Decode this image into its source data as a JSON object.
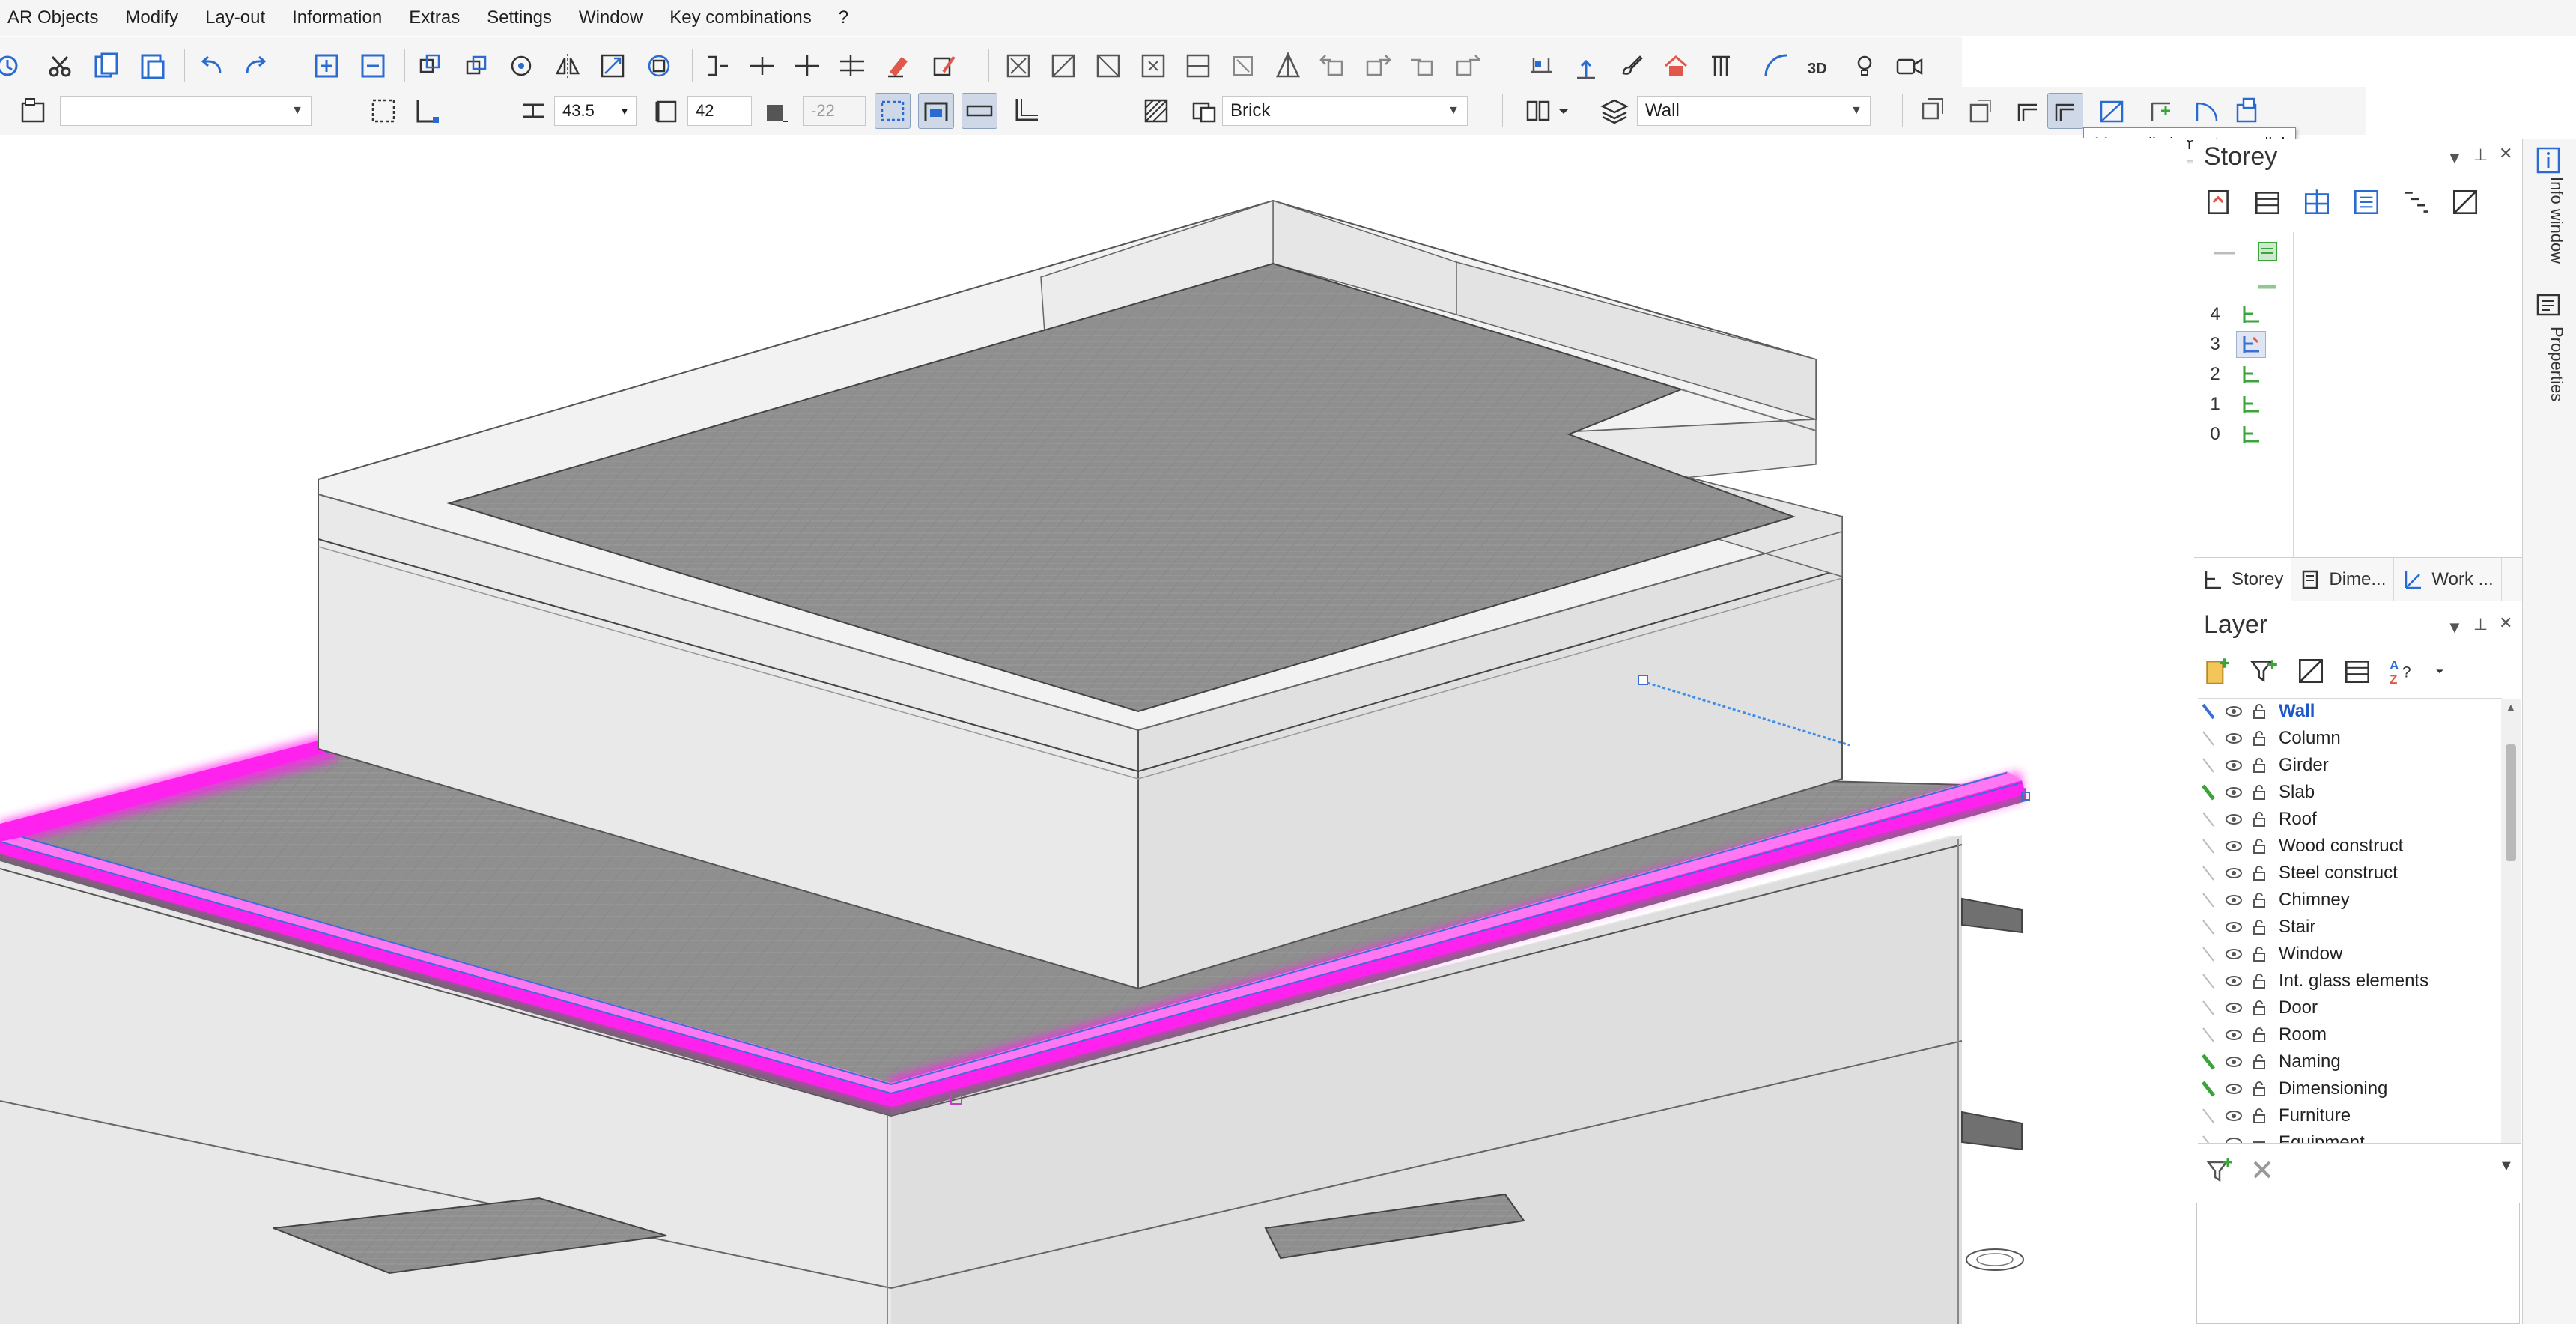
{
  "menu": [
    "AR Objects",
    "Modify",
    "Lay-out",
    "Information",
    "Extras",
    "Settings",
    "Window",
    "Key combinations",
    "?"
  ],
  "toolbar2": {
    "thickness_value": "43.5",
    "height_value": "42",
    "offset_value": "-22",
    "material": "Brick",
    "layer": "Wall"
  },
  "tooltip": "Move all elements parallel",
  "storey_panel": {
    "title": "Storey",
    "storeys": [
      "4",
      "3",
      "2",
      "1",
      "0"
    ],
    "selected": "3",
    "tabs": [
      "Storey",
      "Dime...",
      "Work ..."
    ]
  },
  "layer_panel": {
    "title": "Layer",
    "current": "Wall",
    "layers": [
      "Wall",
      "Column",
      "Girder",
      "Slab",
      "Roof",
      "Wood construct",
      "Steel construct",
      "Chimney",
      "Stair",
      "Window",
      "Int. glass elements",
      "Door",
      "Room",
      "Naming",
      "Dimensioning",
      "Furniture",
      "Equipment"
    ],
    "icons": {
      "hide": "eye-icon",
      "lock": "lock-icon",
      "filter": "filter-add-icon",
      "clear": "close-icon"
    }
  },
  "side_tabs": [
    "Info window",
    "Properties"
  ],
  "colors": {
    "selection": "#ff22ee",
    "current_layer": "#1f57c6",
    "wall_face": "#e6e6e6",
    "slab": "#8f8f8f"
  }
}
